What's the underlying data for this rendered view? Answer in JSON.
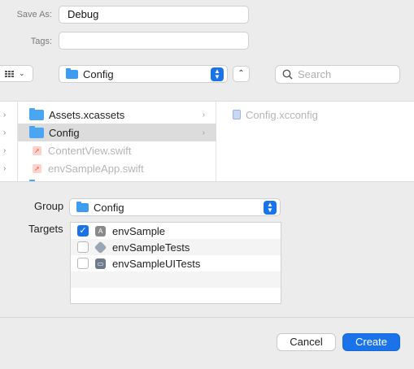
{
  "save_as": {
    "label": "Save As:",
    "value": "Debug"
  },
  "tags": {
    "label": "Tags:",
    "value": ""
  },
  "toolbar": {
    "location": "Config",
    "search_placeholder": "Search"
  },
  "browser": {
    "column1": [
      {
        "name": "Assets.xcassets",
        "kind": "folder",
        "selected": false,
        "disabled": false
      },
      {
        "name": "Config",
        "kind": "folder",
        "selected": true,
        "disabled": false
      },
      {
        "name": "ContentView.swift",
        "kind": "swift",
        "selected": false,
        "disabled": true
      },
      {
        "name": "envSampleApp.swift",
        "kind": "swift",
        "selected": false,
        "disabled": true
      }
    ],
    "column2": [
      {
        "name": "Config.xcconfig",
        "kind": "xcconfig",
        "disabled": true
      }
    ]
  },
  "group": {
    "label": "Group",
    "value": "Config"
  },
  "targets": {
    "label": "Targets",
    "items": [
      {
        "name": "envSample",
        "checked": true,
        "icon": "app-target-icon"
      },
      {
        "name": "envSampleTests",
        "checked": false,
        "icon": "test-target-icon"
      },
      {
        "name": "envSampleUITests",
        "checked": false,
        "icon": "ui-test-target-icon"
      }
    ]
  },
  "buttons": {
    "cancel": "Cancel",
    "create": "Create"
  },
  "colors": {
    "accent": "#1a73e8",
    "folder": "#3d9cf0"
  }
}
